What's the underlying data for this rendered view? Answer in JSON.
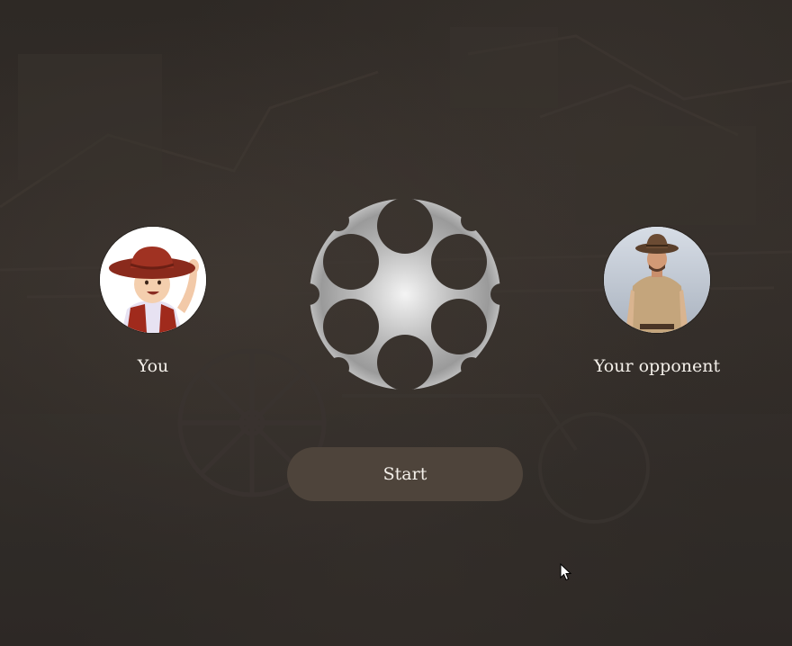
{
  "players": {
    "you": {
      "name": "You",
      "avatar": "cowboy-baby-avatar"
    },
    "opponent": {
      "name": "Your opponent",
      "avatar": "cowboy-man-avatar"
    }
  },
  "revolver": {
    "chambers": 6,
    "icon": "revolver-cylinder-icon"
  },
  "start_button": {
    "label": "Start"
  },
  "colors": {
    "background": "#2b2622",
    "button": "#4e443b",
    "text": "#f4f0ea"
  }
}
